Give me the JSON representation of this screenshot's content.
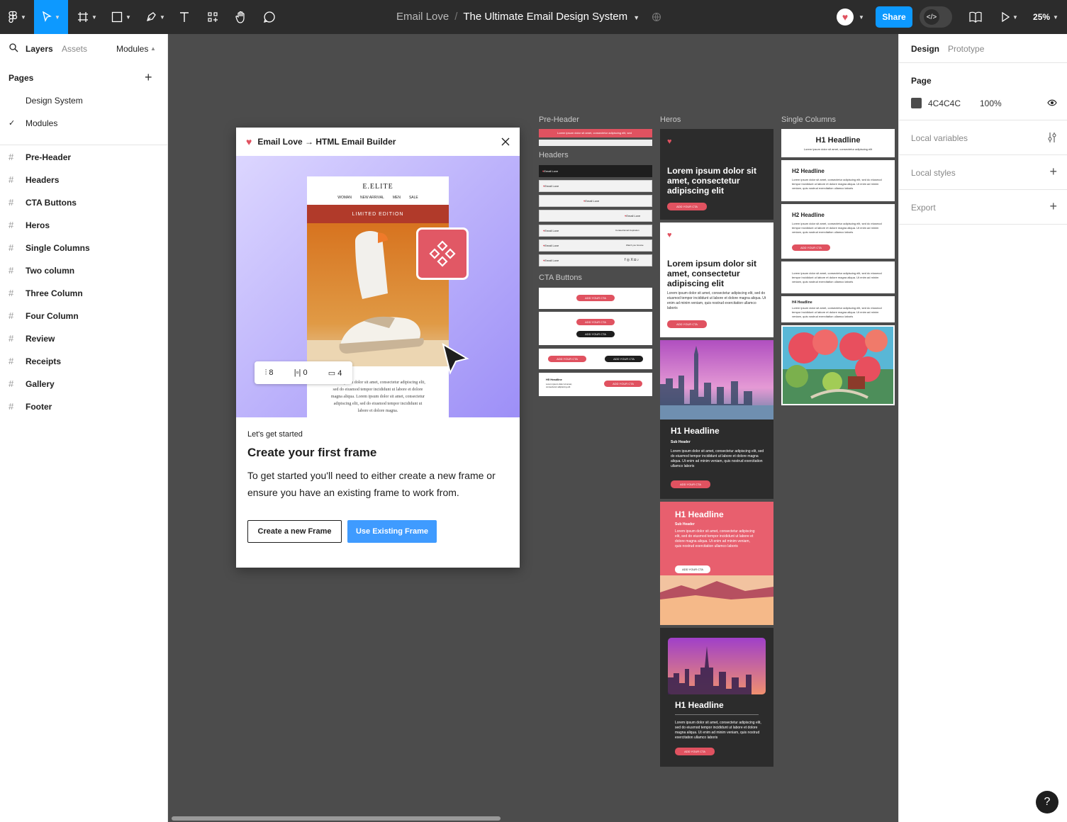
{
  "topbar": {
    "project": "Email Love",
    "file_title": "The Ultimate Email Design System",
    "share_label": "Share",
    "zoom": "25%"
  },
  "left_panel": {
    "tabs": {
      "layers": "Layers",
      "assets": "Assets",
      "modules": "Modules"
    },
    "pages_title": "Pages",
    "pages": [
      "Design System",
      "Modules"
    ],
    "layers": [
      "Pre-Header",
      "Headers",
      "CTA Buttons",
      "Heros",
      "Single Columns",
      "Two column",
      "Three Column",
      "Four Column",
      "Review",
      "Receipts",
      "Gallery",
      "Footer"
    ]
  },
  "right_panel": {
    "tabs": {
      "design": "Design",
      "prototype": "Prototype"
    },
    "page_label": "Page",
    "page_color": "4C4C4C",
    "page_opacity": "100%",
    "local_variables": "Local variables",
    "local_styles": "Local styles",
    "export": "Export",
    "help": "?"
  },
  "modal": {
    "title": "Email Love → HTML Email Builder",
    "email_brand": "E.ELITE",
    "email_nav": [
      "WOMAN",
      "NEW ARRIVAL",
      "MEN",
      "SALE"
    ],
    "limited": "LIMITED EDITION",
    "email_text": "Lorem ipsum dolor sit amet, consectetur adipiscing elit, sed do eiusmod tempor incididunt ut labore et dolore magna aliqua. Lorem ipsum dolor sit amet, consectetur adipiscing elit, sed do eiusmod tempor incididunt ut labore et dolore magna.",
    "spacing": [
      "8",
      "0",
      "4"
    ],
    "eyebrow": "Let's get started",
    "heading": "Create your first frame",
    "body": "To get started you'll need to either create a new frame or ensure you have an existing frame to work from.",
    "btn_new": "Create a new Frame",
    "btn_existing": "Use Existing Frame"
  },
  "canvas": {
    "labels": {
      "preheader": "Pre-Header",
      "headers": "Headers",
      "cta": "CTA Buttons",
      "heros": "Heros",
      "single": "Single Columns"
    },
    "preheader_text": "Lorem ipsum dolor sit amet, consectetur adipiscing elit, sed",
    "header_logo": "Email Love",
    "header_links": [
      "Curated Email Inspiration",
      "Watch you browse"
    ],
    "cta_label": "ADD YOUR CTA",
    "h5": "H5 Headline",
    "hero_big": "Lorem ipsum dolor sit amet, consectetur adipiscing elit",
    "h1": "H1 Headline",
    "h2": "H2 Headline",
    "h4": "H4 Headline",
    "sub_header": "Sub Header",
    "lorem": "Lorem ipsum dolor sit amet, consectetur adipiscing elit, sed do eiusmod tempor incididunt ut labore et dolore magna aliqua. Ut enim ad minim veniam, quis nostrud exercitation ullamco laboris",
    "h1_sub": "Lorem ipsum dolor sit amet, consectetur adipiscing elit"
  },
  "colors": {
    "accent": "#0d99ff",
    "brand": "#e05260",
    "canvas": "#4c4c4c"
  }
}
